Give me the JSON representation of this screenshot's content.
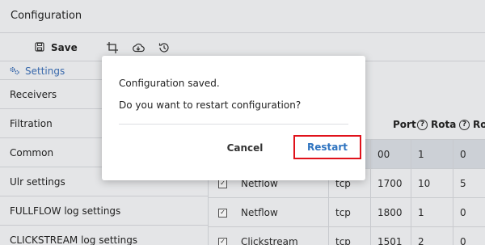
{
  "window": {
    "title": "Configuration"
  },
  "toolbar": {
    "save_label": "Save",
    "icons": [
      "save-icon",
      "crop-icon",
      "download-icon",
      "history-icon"
    ]
  },
  "sidebar": {
    "tab_label": "Settings",
    "items": [
      {
        "label": "Receivers"
      },
      {
        "label": "Filtration"
      },
      {
        "label": "Common"
      },
      {
        "label": "Ulr settings"
      },
      {
        "label": "FULLFLOW log settings"
      },
      {
        "label": "CLICKSTREAM log settings"
      }
    ]
  },
  "grid": {
    "headers": {
      "port": "Port",
      "rota": "Rota",
      "ro": "Ro",
      "help": "?"
    },
    "rows": [
      {
        "type": "",
        "protocol": "",
        "port": "00",
        "rota": "1",
        "ro": "0",
        "selected": true
      },
      {
        "type": "Netflow",
        "protocol": "tcp",
        "port": "1700",
        "rota": "10",
        "ro": "5",
        "selected": false
      },
      {
        "type": "Netflow",
        "protocol": "tcp",
        "port": "1800",
        "rota": "1",
        "ro": "0",
        "selected": false
      },
      {
        "type": "Clickstream",
        "protocol": "tcp",
        "port": "1501",
        "rota": "2",
        "ro": "0",
        "selected": false
      }
    ],
    "check_mark": "✓"
  },
  "dialog": {
    "line1": "Configuration saved.",
    "line2": "Do you want to restart configuration?",
    "cancel_label": "Cancel",
    "restart_label": "Restart"
  },
  "colors": {
    "accent": "#2f74c0",
    "highlight": "#e0121b",
    "sidebar_tab": "#3c6fb6"
  }
}
